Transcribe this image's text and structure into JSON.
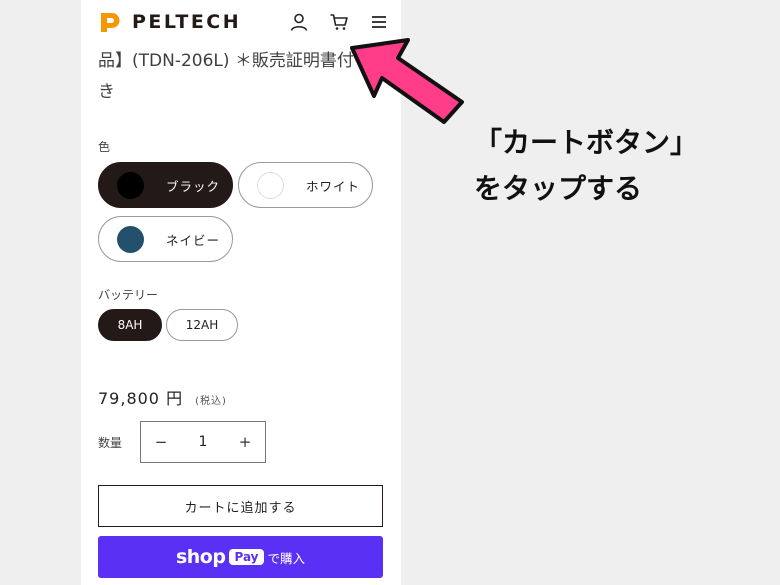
{
  "header": {
    "brand": "PELTECH",
    "icons": [
      "account-icon",
      "cart-icon",
      "menu-icon"
    ]
  },
  "product": {
    "title": "品】(TDN-206L) ＊販売証明書付\nき"
  },
  "color_option": {
    "label": "色",
    "options": [
      {
        "label": "ブラック",
        "swatch": "#000000",
        "selected": true
      },
      {
        "label": "ホワイト",
        "swatch": "#ffffff",
        "selected": false
      },
      {
        "label": "ネイビー",
        "swatch": "#23506c",
        "selected": false
      }
    ]
  },
  "battery_option": {
    "label": "バッテリー",
    "options": [
      {
        "label": "8AH",
        "selected": true
      },
      {
        "label": "12AH",
        "selected": false
      }
    ]
  },
  "price": {
    "value": "79,800 円",
    "tax": "(税込)"
  },
  "quantity": {
    "label": "数量",
    "minus": "−",
    "value": "1",
    "plus": "+"
  },
  "buttons": {
    "add_to_cart": "カートに追加する",
    "shop_word": "shop",
    "pay_badge": "Pay",
    "pay_suffix": "で購入"
  },
  "annotation": {
    "text": "「カートボタン」\nをタップする"
  },
  "colors": {
    "selected_bg": "#231916",
    "shop_pay": "#5a31f4",
    "arrow": "#ff3d88",
    "logo_orange": "#f39800"
  }
}
